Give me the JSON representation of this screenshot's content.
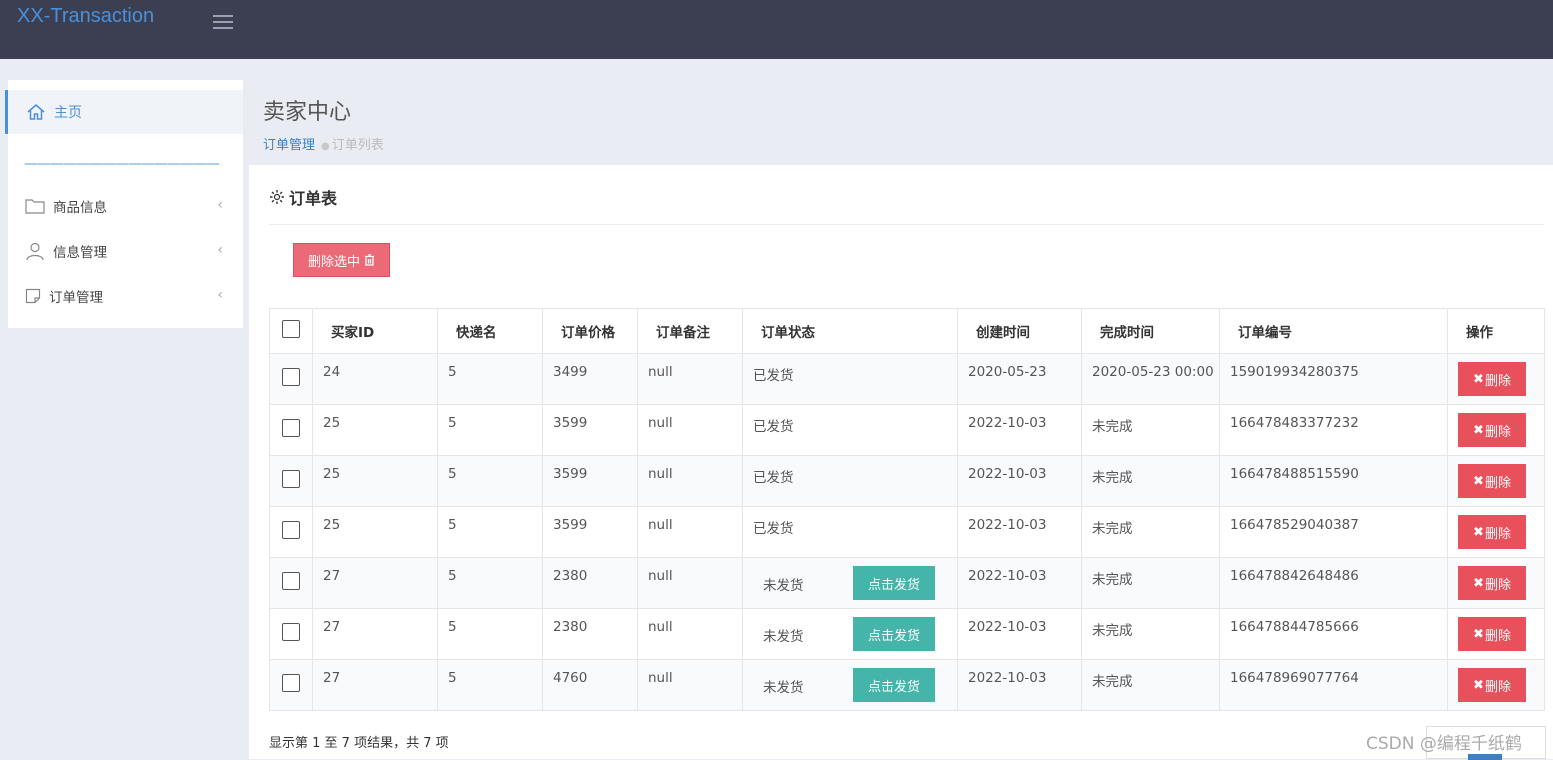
{
  "app": {
    "brand": "XX-Transaction"
  },
  "sidebar": {
    "home": "主页",
    "divider": "———————————————",
    "items": [
      {
        "label": "商品信息",
        "icon": "folder-icon"
      },
      {
        "label": "信息管理",
        "icon": "user-icon"
      },
      {
        "label": "订单管理",
        "icon": "note-icon"
      }
    ]
  },
  "header": {
    "title": "卖家中心",
    "breadcrumb": {
      "parent": "订单管理",
      "current": "订单列表"
    }
  },
  "panel": {
    "title": "订单表",
    "delete_selected": "删除选中",
    "columns": [
      "买家ID",
      "快递名",
      "订单价格",
      "订单备注",
      "订单状态",
      "创建时间",
      "完成时间",
      "订单编号",
      "操作"
    ],
    "rows": [
      {
        "buyer": "24",
        "express": "5",
        "price": "3499",
        "note": "null",
        "status": "已发货",
        "created": "2020-05-23",
        "done": "2020-05-23 00:00",
        "order_no": "159019934280375",
        "ship": false
      },
      {
        "buyer": "25",
        "express": "5",
        "price": "3599",
        "note": "null",
        "status": "已发货",
        "created": "2022-10-03",
        "done": "未完成",
        "order_no": "166478483377232",
        "ship": false
      },
      {
        "buyer": "25",
        "express": "5",
        "price": "3599",
        "note": "null",
        "status": "已发货",
        "created": "2022-10-03",
        "done": "未完成",
        "order_no": "166478488515590",
        "ship": false
      },
      {
        "buyer": "25",
        "express": "5",
        "price": "3599",
        "note": "null",
        "status": "已发货",
        "created": "2022-10-03",
        "done": "未完成",
        "order_no": "166478529040387",
        "ship": false
      },
      {
        "buyer": "27",
        "express": "5",
        "price": "2380",
        "note": "null",
        "status": "未发货",
        "created": "2022-10-03",
        "done": "未完成",
        "order_no": "166478842648486",
        "ship": true
      },
      {
        "buyer": "27",
        "express": "5",
        "price": "2380",
        "note": "null",
        "status": "未发货",
        "created": "2022-10-03",
        "done": "未完成",
        "order_no": "166478844785666",
        "ship": true
      },
      {
        "buyer": "27",
        "express": "5",
        "price": "4760",
        "note": "null",
        "status": "未发货",
        "created": "2022-10-03",
        "done": "未完成",
        "order_no": "166478969077764",
        "ship": true
      }
    ],
    "ship_button": "点击发货",
    "delete_button": "删除",
    "footer": "显示第 1 至 7 项结果，共 7 项"
  },
  "watermark": "CSDN @编程千纸鹤",
  "colors": {
    "topbar": "#3c3f52",
    "accent": "#4a90d9",
    "danger": "#e8505b",
    "ship": "#45b5aa"
  }
}
